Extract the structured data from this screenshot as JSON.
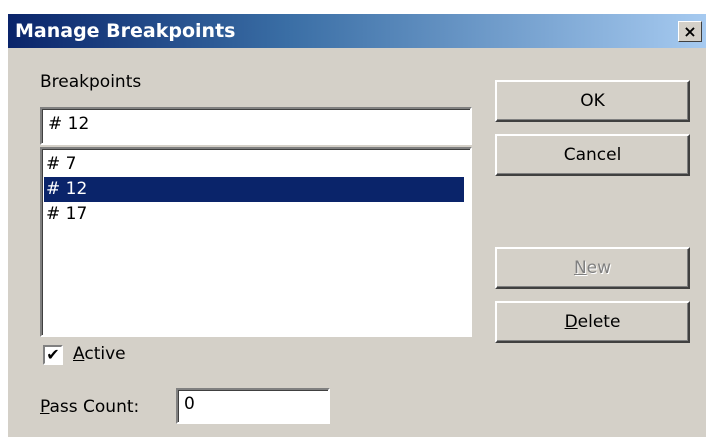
{
  "window": {
    "title": "Manage Breakpoints",
    "close_glyph": "×"
  },
  "breakpoints": {
    "label": "Breakpoints",
    "selected_value": "# 12",
    "items": [
      "# 7",
      "# 12",
      "# 17"
    ],
    "selected_index": 1
  },
  "buttons": {
    "ok": "OK",
    "cancel": "Cancel",
    "new_mnemonic": "N",
    "new_rest": "ew",
    "new_enabled": false,
    "delete_mnemonic": "D",
    "delete_rest": "elete"
  },
  "active": {
    "checked": true,
    "check_glyph": "✔",
    "mnemonic": "A",
    "rest": "ctive"
  },
  "pass_count": {
    "mnemonic": "P",
    "rest": "ass Count:",
    "value": "0"
  },
  "colors": {
    "selection": "#0a246a",
    "face": "#d4d0c8"
  }
}
